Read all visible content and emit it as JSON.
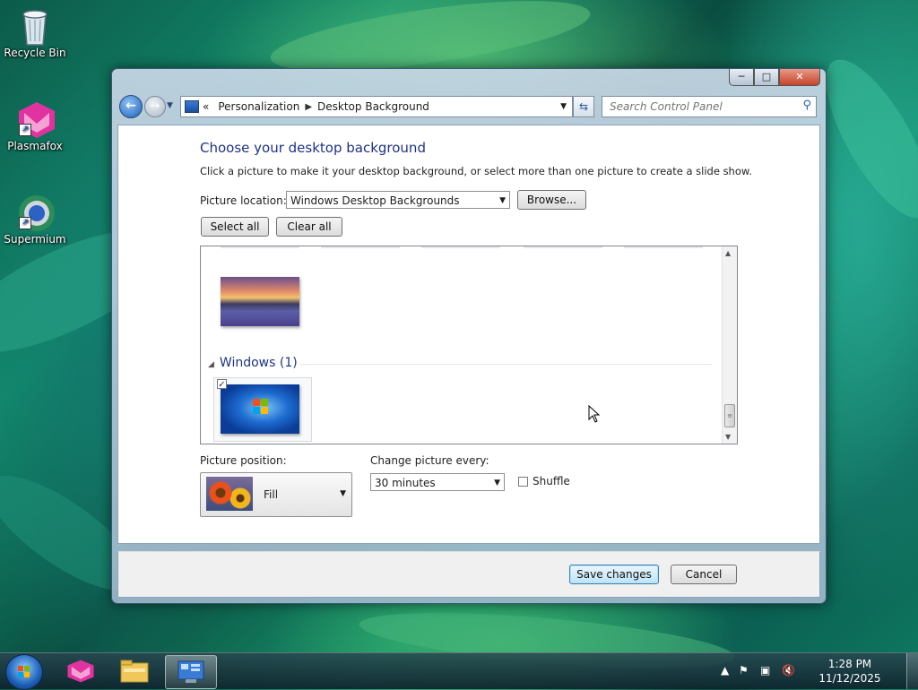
{
  "desktop": {
    "icons": [
      {
        "label": "Recycle Bin",
        "icon": "recycle-bin-icon"
      },
      {
        "label": "Plasmafox",
        "icon": "plasmafox-icon"
      },
      {
        "label": "Supermium",
        "icon": "supermium-icon"
      }
    ]
  },
  "window": {
    "caption_buttons": {
      "minimize": "─",
      "maximize": "□",
      "close": "✕"
    },
    "breadcrumb": [
      "Personalization",
      "Desktop Background"
    ],
    "breadcrumb_prefix": "«",
    "search_placeholder": "Search Control Panel",
    "heading": "Choose your desktop background",
    "instructions": "Click a picture to make it your desktop background, or select more than one picture to create a slide show.",
    "picture_location": {
      "label": "Picture location:",
      "value": "Windows Desktop Backgrounds"
    },
    "browse_label": "Browse...",
    "select_all_label": "Select all",
    "clear_all_label": "Clear all",
    "gallery": {
      "group_name": "Windows (1)",
      "selected_checkmark": "✓"
    },
    "picture_position": {
      "label": "Picture position:",
      "value": "Fill"
    },
    "change_picture": {
      "label": "Change picture every:",
      "value": "30 minutes"
    },
    "shuffle_label": "Shuffle",
    "save_label": "Save changes",
    "cancel_label": "Cancel"
  },
  "taskbar": {
    "clock_time": "1:28 PM",
    "clock_date": "11/12/2025",
    "tray_icons": [
      "show-hidden-icons-icon",
      "action-center-flag-icon",
      "network-icon",
      "volume-muted-icon"
    ]
  },
  "colors": {
    "heading_blue": "#1e3287",
    "accent_blue": "#1f5fb8"
  }
}
